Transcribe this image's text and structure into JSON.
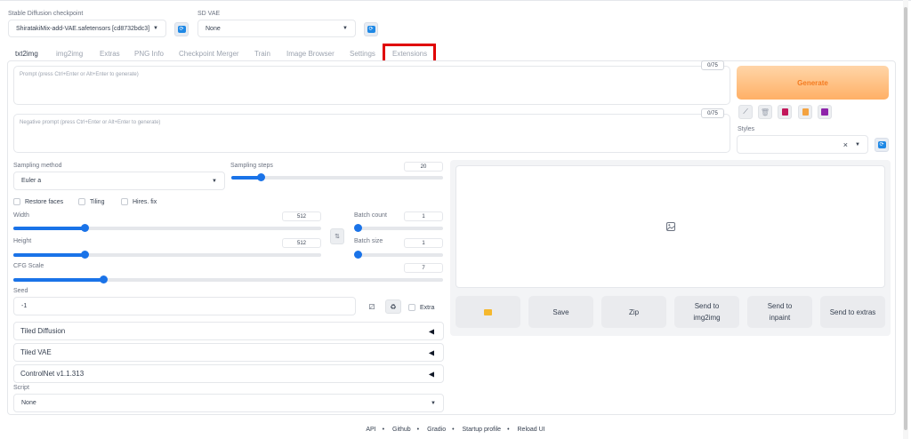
{
  "checkpoint": {
    "label": "Stable Diffusion checkpoint",
    "value": "ShiratakiMix-add-VAE.safetensors [cd8732bdc3]"
  },
  "vae": {
    "label": "SD VAE",
    "value": "None"
  },
  "tabs": [
    "txt2img",
    "img2img",
    "Extras",
    "PNG Info",
    "Checkpoint Merger",
    "Train",
    "Image Browser",
    "Settings",
    "Extensions"
  ],
  "active_tab": "txt2img",
  "highlighted_tab": "Extensions",
  "highlight_color": "#e00000",
  "prompt": {
    "placeholder": "Prompt (press Ctrl+Enter or Alt+Enter to generate)",
    "counter": "0/75"
  },
  "negative_prompt": {
    "placeholder": "Negative prompt (press Ctrl+Enter or Alt+Enter to generate)",
    "counter": "0/75"
  },
  "generate_label": "Generate",
  "tool_icons": [
    "paint-brush-icon",
    "trash-icon",
    "red-book-icon",
    "clipboard-icon",
    "save-floppy-icon"
  ],
  "styles": {
    "label": "Styles",
    "clear": "×"
  },
  "sampling": {
    "method_label": "Sampling method",
    "method_value": "Euler a",
    "steps_label": "Sampling steps",
    "steps_value": "20",
    "steps_fraction": 0.14
  },
  "checkboxes": [
    "Restore faces",
    "Tiling",
    "Hires. fix"
  ],
  "width": {
    "label": "Width",
    "value": "512",
    "fraction": 0.23
  },
  "height": {
    "label": "Height",
    "value": "512",
    "fraction": 0.23
  },
  "batch_count": {
    "label": "Batch count",
    "value": "1",
    "fraction": 0.0
  },
  "batch_size": {
    "label": "Batch size",
    "value": "1",
    "fraction": 0.0
  },
  "cfg": {
    "label": "CFG Scale",
    "value": "7",
    "fraction": 0.21
  },
  "seed": {
    "label": "Seed",
    "value": "-1",
    "extra_label": "Extra"
  },
  "accordions": [
    "Tiled Diffusion",
    "Tiled VAE",
    "ControlNet v1.1.313"
  ],
  "script": {
    "label": "Script",
    "value": "None"
  },
  "output_buttons": {
    "folder": "folder-icon",
    "save": "Save",
    "zip": "Zip",
    "send_img2img": "Send to img2img",
    "send_inpaint": "Send to inpaint",
    "send_extras": "Send to extras"
  },
  "footer": [
    "API",
    "Github",
    "Gradio",
    "Startup profile",
    "Reload UI"
  ],
  "footer_separator": "•",
  "accent_color": "#1a73e8",
  "generate_color": "#f47b20"
}
